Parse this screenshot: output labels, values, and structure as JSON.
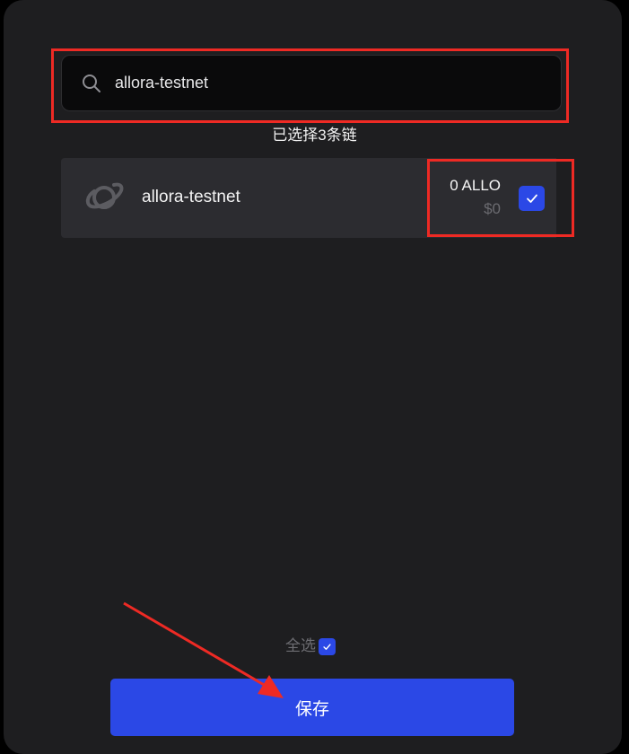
{
  "search": {
    "value": "allora-testnet",
    "icon": "search-icon"
  },
  "selected_count_text": "已选择3条链",
  "chains": [
    {
      "name": "allora-testnet",
      "icon": "planet-icon",
      "balance": "0 ALLO",
      "fiat": "$0",
      "checked": true
    }
  ],
  "select_all": {
    "label": "全选",
    "checked": true
  },
  "save_label": "保存",
  "colors": {
    "accent": "#2b48e6",
    "panel": "#1e1e20",
    "row": "#2c2c30",
    "highlight": "#ee2a24"
  }
}
